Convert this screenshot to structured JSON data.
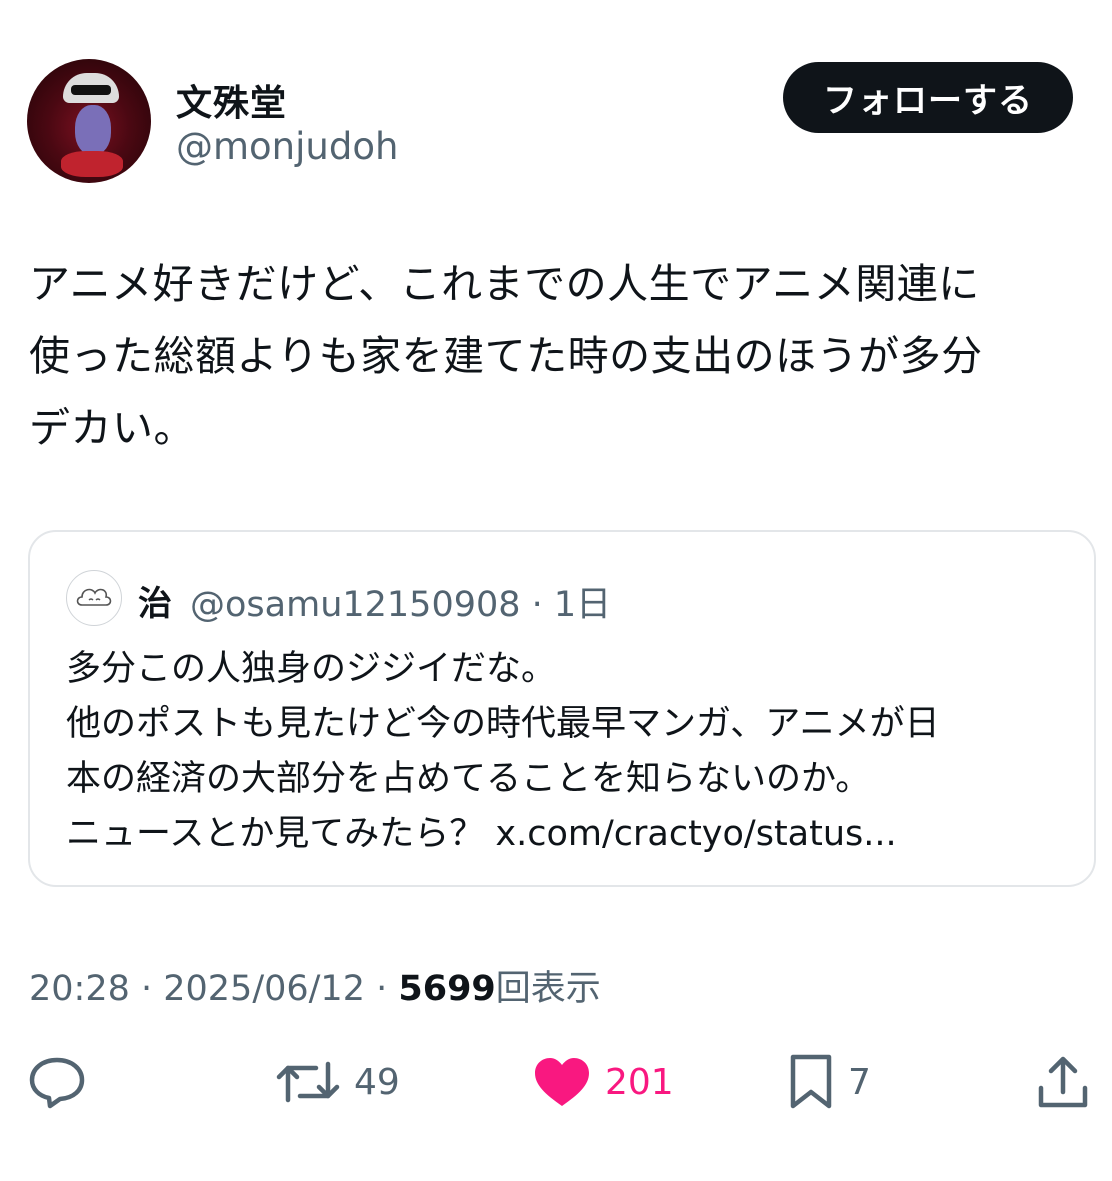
{
  "author": {
    "name": "文殊堂",
    "handle": "@monjudoh",
    "avatar_icon": "avatar-icon"
  },
  "follow_label": "フォローする",
  "tweet": {
    "text": "アニメ好きだけど、これまでの人生でアニメ関連に\n使った総額よりも家を建てた時の支出のほうが多分\nデカい。"
  },
  "quote": {
    "name": "治",
    "handle_time": "@osamu12150908 · 1日",
    "text": "多分この人独身のジジイだな。\n他のポストも見たけど今の時代最早マンガ、アニメが日\n本の経済の大部分を占めてることを知らないのか。\nニュースとか見てみたら？ x.com/cractyo/status..."
  },
  "meta": {
    "time_date": "20:28 · 2025/06/12 · ",
    "views_count": "5699",
    "views_label": "回表示"
  },
  "actions": {
    "reply_icon": "reply-icon",
    "retweet_count": "49",
    "like_count": "201",
    "bookmark_count": "7",
    "share_icon": "share-icon"
  },
  "colors": {
    "text": "#0f1419",
    "muted": "#536471",
    "like": "#f91880",
    "border": "#e3e6e9"
  }
}
